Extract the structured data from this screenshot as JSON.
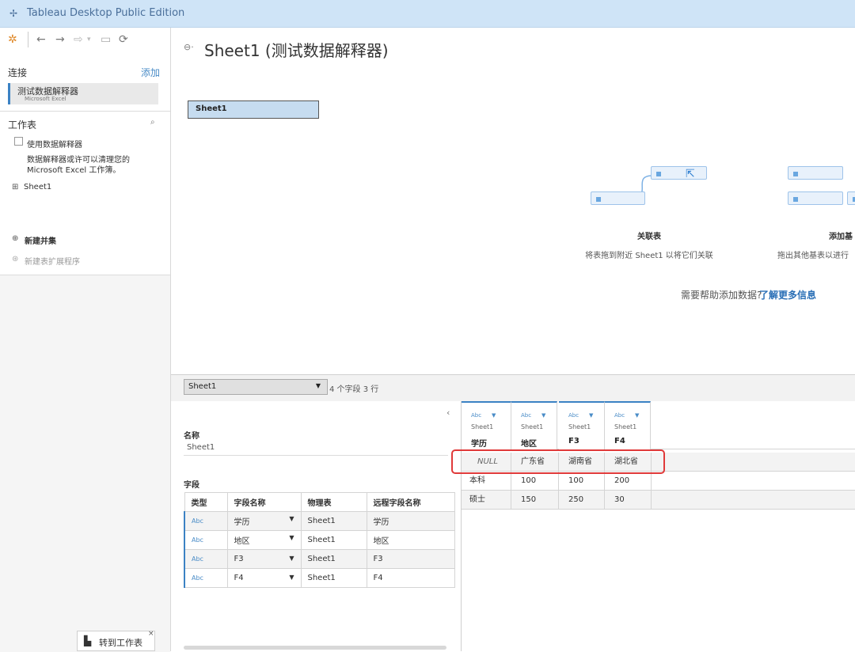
{
  "titlebar": {
    "logo": "✢",
    "title": "Tableau Desktop Public Edition"
  },
  "toolbar": {
    "icons": [
      "tableau-icon",
      "back-icon",
      "forward-icon",
      "forward-disabled-icon",
      "save-icon",
      "refresh-icon"
    ]
  },
  "left": {
    "connections_label": "连接",
    "add_label": "添加",
    "connection": {
      "name": "测试数据解释器",
      "type": "Microsoft Excel"
    },
    "sheets_label": "工作表",
    "use_interpreter": "使用数据解释器",
    "interpreter_desc_1": "数据解释器或许可以清理您的",
    "interpreter_desc_2": "Microsoft Excel 工作簿。",
    "sheet_item": "Sheet1",
    "new_union": "新建并集",
    "new_extension": "新建表扩展程序",
    "goto_sheet": "转到工作表"
  },
  "canvas": {
    "title": "Sheet1 (测试数据解释器)",
    "sheet_box": "Sheet1",
    "relate_title": "关联表",
    "relate_desc": "将表拖到附近 Sheet1 以将它们关联",
    "add_title": "添加基",
    "add_desc": "拖出其他基表以进行",
    "help_text": "需要帮助添加数据?",
    "help_link": "了解更多信息"
  },
  "bottom": {
    "sheet_select": "Sheet1",
    "info": "4 个字段 3 行"
  },
  "meta": {
    "name_label": "名称",
    "name_value": "Sheet1",
    "fields_label": "字段",
    "headers": [
      "类型",
      "字段名称",
      "物理表",
      "远程字段名称"
    ],
    "rows": [
      {
        "type": "Abc",
        "name": "学历",
        "table": "Sheet1",
        "remote": "学历"
      },
      {
        "type": "Abc",
        "name": "地区",
        "table": "Sheet1",
        "remote": "地区"
      },
      {
        "type": "Abc",
        "name": "F3",
        "table": "Sheet1",
        "remote": "F3"
      },
      {
        "type": "Abc",
        "name": "F4",
        "table": "Sheet1",
        "remote": "F4"
      }
    ]
  },
  "grid": {
    "columns": [
      {
        "type": "Abc",
        "source": "Sheet1",
        "name": "学历"
      },
      {
        "type": "Abc",
        "source": "Sheet1",
        "name": "地区"
      },
      {
        "type": "Abc",
        "source": "Sheet1",
        "name": "F3"
      },
      {
        "type": "Abc",
        "source": "Sheet1",
        "name": "F4"
      }
    ],
    "rows": [
      [
        "NULL",
        "广东省",
        "湖南省",
        "湖北省"
      ],
      [
        "本科",
        "100",
        "100",
        "200"
      ],
      [
        "硕士",
        "150",
        "250",
        "30"
      ]
    ]
  }
}
